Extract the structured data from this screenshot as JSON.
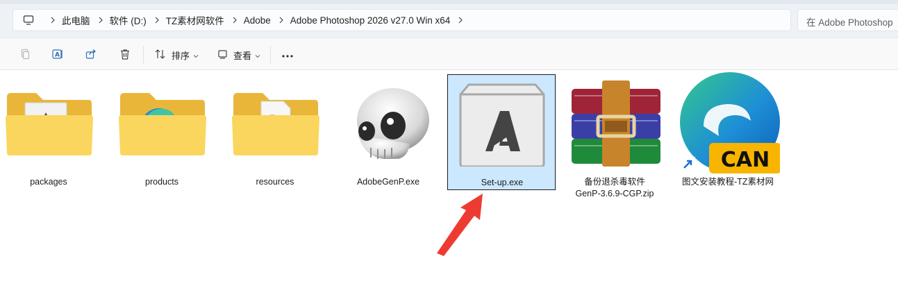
{
  "address": {
    "crumbs": [
      "此电脑",
      "软件 (D:)",
      "TZ素材网软件",
      "Adobe",
      "Adobe Photoshop 2026 v27.0 Win x64"
    ],
    "icons": {
      "pc": "computer-icon",
      "separator": "chevron-right-icon"
    }
  },
  "search": {
    "placeholder": "在 Adobe Photoshop"
  },
  "toolbar": {
    "sort_label": "排序",
    "view_label": "查看",
    "icons": [
      "copy-icon",
      "rename-icon",
      "share-icon",
      "delete-icon",
      "sort-icon",
      "view-icon",
      "more-icon"
    ]
  },
  "files": [
    {
      "name": "packages",
      "type": "folder"
    },
    {
      "name": "products",
      "type": "folder"
    },
    {
      "name": "resources",
      "type": "folder"
    },
    {
      "name": "AdobeGenP.exe",
      "type": "exe"
    },
    {
      "name": "Set-up.exe",
      "type": "exe",
      "selected": true
    },
    {
      "name_line1": "备份退杀毒软件",
      "name_line2": "GenP-3.6.9-CGP.zip",
      "type": "zip"
    },
    {
      "name": "图文安装教程-TZ素材网",
      "type": "shortcut",
      "badge": "CAN"
    }
  ],
  "colors": {
    "folder_back": "#e9b63a",
    "folder_front": "#fbd65e",
    "selection_bg": "#cce8ff",
    "arrow": "#ee3b32",
    "can_badge": "#f7b500"
  }
}
